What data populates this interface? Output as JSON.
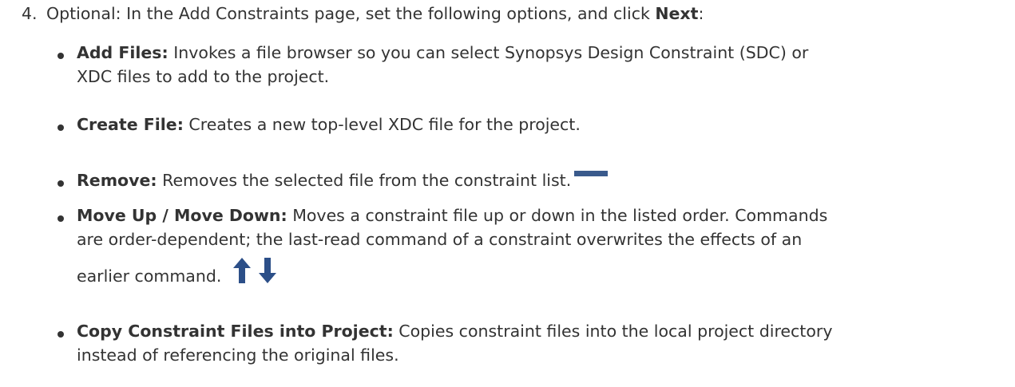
{
  "step": {
    "number": "4.",
    "text_before": "Optional: In the Add Constraints page, set the following options, and click ",
    "next_label": "Next",
    "text_after": ":"
  },
  "bullets": [
    {
      "term": "Add Files:",
      "lines": [
        " Invokes a file browser so you can select Synopsys Design Constraint (SDC) or",
        "XDC files to add to the project."
      ]
    },
    {
      "term": "Create File:",
      "lines": [
        " Creates a new top-level XDC file for the project."
      ]
    },
    {
      "term": "Remove:",
      "lines": [
        " Removes the selected file from the constraint list."
      ],
      "icon": "remove-minus-icon"
    },
    {
      "term": "Move Up / Move Down:",
      "lines": [
        " Moves a constraint file up or down in the listed order. Commands",
        "are order-dependent; the last-read command of a constraint overwrites the effects of an",
        "earlier command."
      ],
      "icons": [
        "arrow-up-icon",
        "arrow-down-icon"
      ]
    },
    {
      "term": "Copy Constraint Files into Project:",
      "lines": [
        " Copies constraint files into the local project directory",
        "instead of referencing the original files."
      ]
    }
  ],
  "colors": {
    "text": "#333333",
    "icon": "#3a5a8c"
  }
}
